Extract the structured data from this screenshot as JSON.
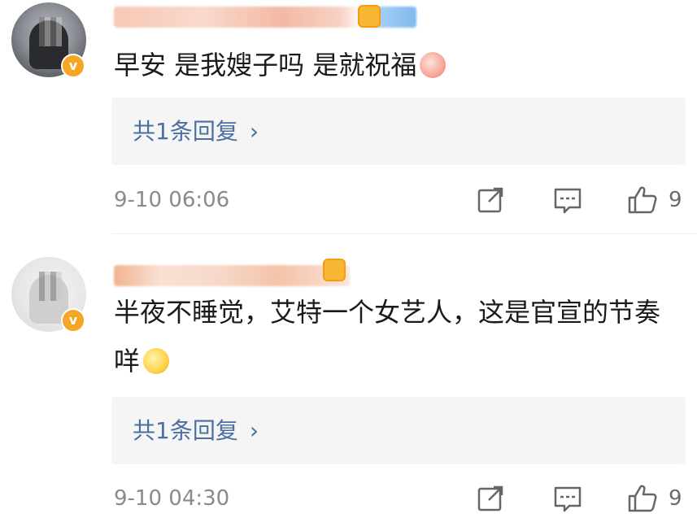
{
  "comments": [
    {
      "text": "早安 是我嫂子吗 是就祝福",
      "emoji": "fan-emoji",
      "reply_label": "共1条回复",
      "reply_chevron": "›",
      "time": "9-10 06:06",
      "likes": "9"
    },
    {
      "text": "半夜不睡觉，艾特一个女艺人，这是官宣的节奏咩",
      "emoji": "thinking-emoji",
      "reply_label": "共1条回复",
      "reply_chevron": "›",
      "time": "9-10 04:30",
      "likes": "9"
    }
  ],
  "badge": "v",
  "icons": [
    "share-icon",
    "comment-icon",
    "like-icon"
  ],
  "colors": {
    "reply_link": "#4a6fa0",
    "verified_badge": "#f5a623",
    "meta_text": "#8a8a8a"
  }
}
